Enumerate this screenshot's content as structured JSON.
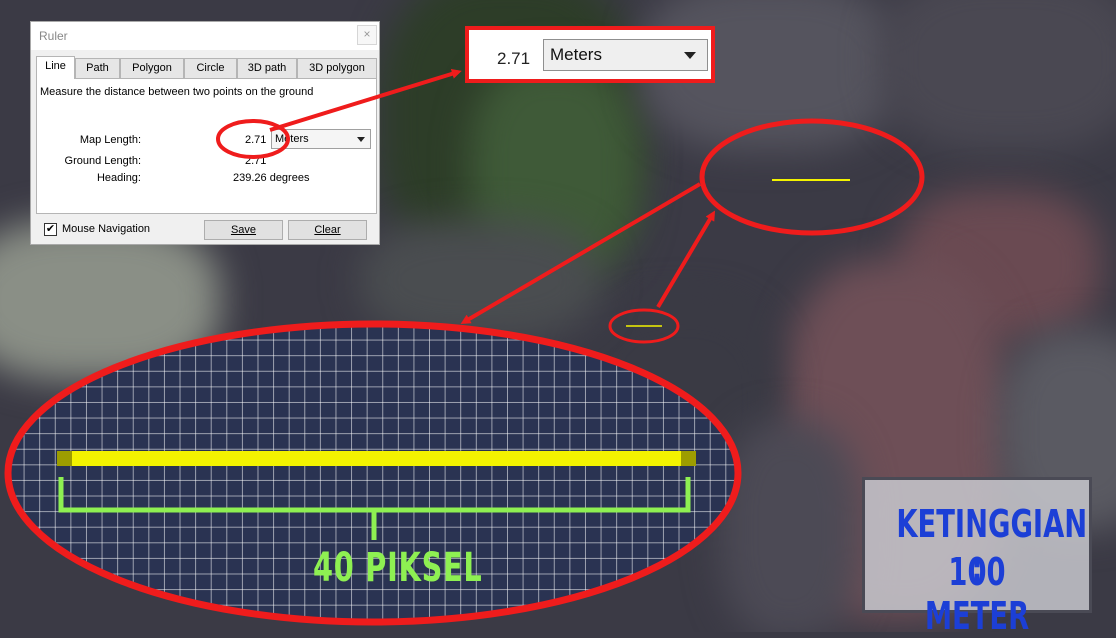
{
  "ruler_dialog": {
    "title": "Ruler",
    "close_glyph": "×",
    "tabs": [
      {
        "label": "Line"
      },
      {
        "label": "Path"
      },
      {
        "label": "Polygon"
      },
      {
        "label": "Circle"
      },
      {
        "label": "3D path"
      },
      {
        "label": "3D polygon"
      }
    ],
    "description": "Measure the distance between two points on the ground",
    "map_length_label": "Map Length:",
    "map_length_value": "2.71",
    "unit_selected": "Meters",
    "ground_length_label": "Ground Length:",
    "ground_length_value": "2.71",
    "heading_label": "Heading:",
    "heading_value": "239.26 degrees",
    "mouse_navigation_label": "Mouse Navigation",
    "mouse_navigation_checked": true,
    "check_glyph": "✔",
    "save_label": "Save",
    "clear_label": "Clear"
  },
  "zoom_callout": {
    "value": "2.71",
    "unit_selected": "Meters"
  },
  "pixel_annotation": {
    "label": "40 PIKSEL",
    "line_pixel_count": 40
  },
  "altitude_box": {
    "line1": "KETINGGIAN :",
    "line2": "100 METER"
  },
  "colors": {
    "annotation_red": "#ef1c1c",
    "measure_yellow": "#f3f300",
    "bracket_green": "#8ef052",
    "altitude_text_blue": "#1c3fd6"
  }
}
